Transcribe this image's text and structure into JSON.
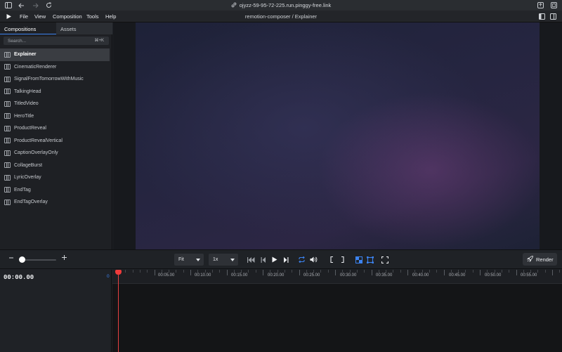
{
  "browser": {
    "url": "ojyzz-59-95-72-225.run.pinggy-free.link"
  },
  "menubar": {
    "items": [
      "File",
      "View",
      "Composition",
      "Tools",
      "Help"
    ],
    "title": "remotion-composer / Explainer"
  },
  "sidebar": {
    "tabs": [
      "Compositions",
      "Assets"
    ],
    "active_tab": "Compositions",
    "search_placeholder": "Search...",
    "search_shortcut": "⌘+K",
    "compositions": [
      "Explainer",
      "CinematicRenderer",
      "SignalFromTomorrowWithMusic",
      "TalkingHead",
      "TitledVideo",
      "HeroTitle",
      "ProductReveal",
      "ProductRevealVertical",
      "CaptionOverlayOnly",
      "CollageBurst",
      "LyricOverlay",
      "EndTag",
      "EndTagOverlay"
    ],
    "selected": "Explainer"
  },
  "controls": {
    "size_select": "Fit",
    "speed_select": "1x",
    "render_label": "Render",
    "accent_color": "#3c83f0"
  },
  "timeline": {
    "timecode": "00:00.00",
    "start_label": "0",
    "tick_labels": [
      "00:05.00",
      "00:10.00",
      "00:15.00",
      "00:20.00",
      "00:25.00",
      "00:30.00",
      "00:35.00",
      "00:40.00",
      "00:45.00",
      "00:50.00",
      "00:55.00"
    ],
    "playhead_color": "#ef3b3b"
  }
}
